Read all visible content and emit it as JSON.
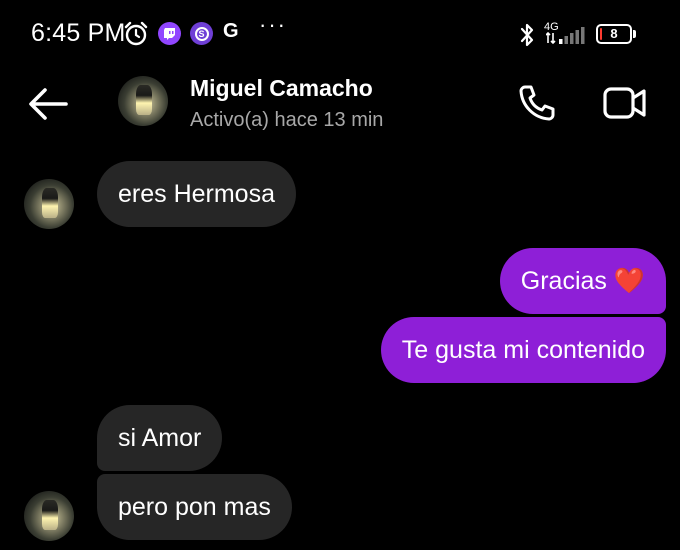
{
  "status_bar": {
    "time": "6:45 PM",
    "network": "4G",
    "battery": "8",
    "battery_level_percent": 8,
    "icons": [
      "alarm-icon",
      "twitch-icon",
      "sp-icon",
      "g-icon",
      "more-icon",
      "bluetooth-icon",
      "signal-icon",
      "battery-icon"
    ],
    "g_label": "G",
    "more_label": "···"
  },
  "header": {
    "contact_name": "Miguel Camacho",
    "contact_status": "Activo(a) hace 13 min",
    "icons": [
      "back-arrow-icon",
      "phone-icon",
      "video-camera-icon"
    ]
  },
  "messages": [
    {
      "direction": "incoming",
      "text": "eres Hermosa"
    },
    {
      "direction": "outgoing",
      "text": "Gracias ❤️"
    },
    {
      "direction": "outgoing",
      "text": "Te gusta mi contenido"
    },
    {
      "direction": "incoming",
      "text": "si Amor"
    },
    {
      "direction": "incoming",
      "text": "pero pon mas"
    }
  ],
  "colors": {
    "background": "#000000",
    "incoming_bubble": "#262626",
    "outgoing_bubble": "#8e1fd7",
    "secondary_text": "#a8a8a8"
  }
}
